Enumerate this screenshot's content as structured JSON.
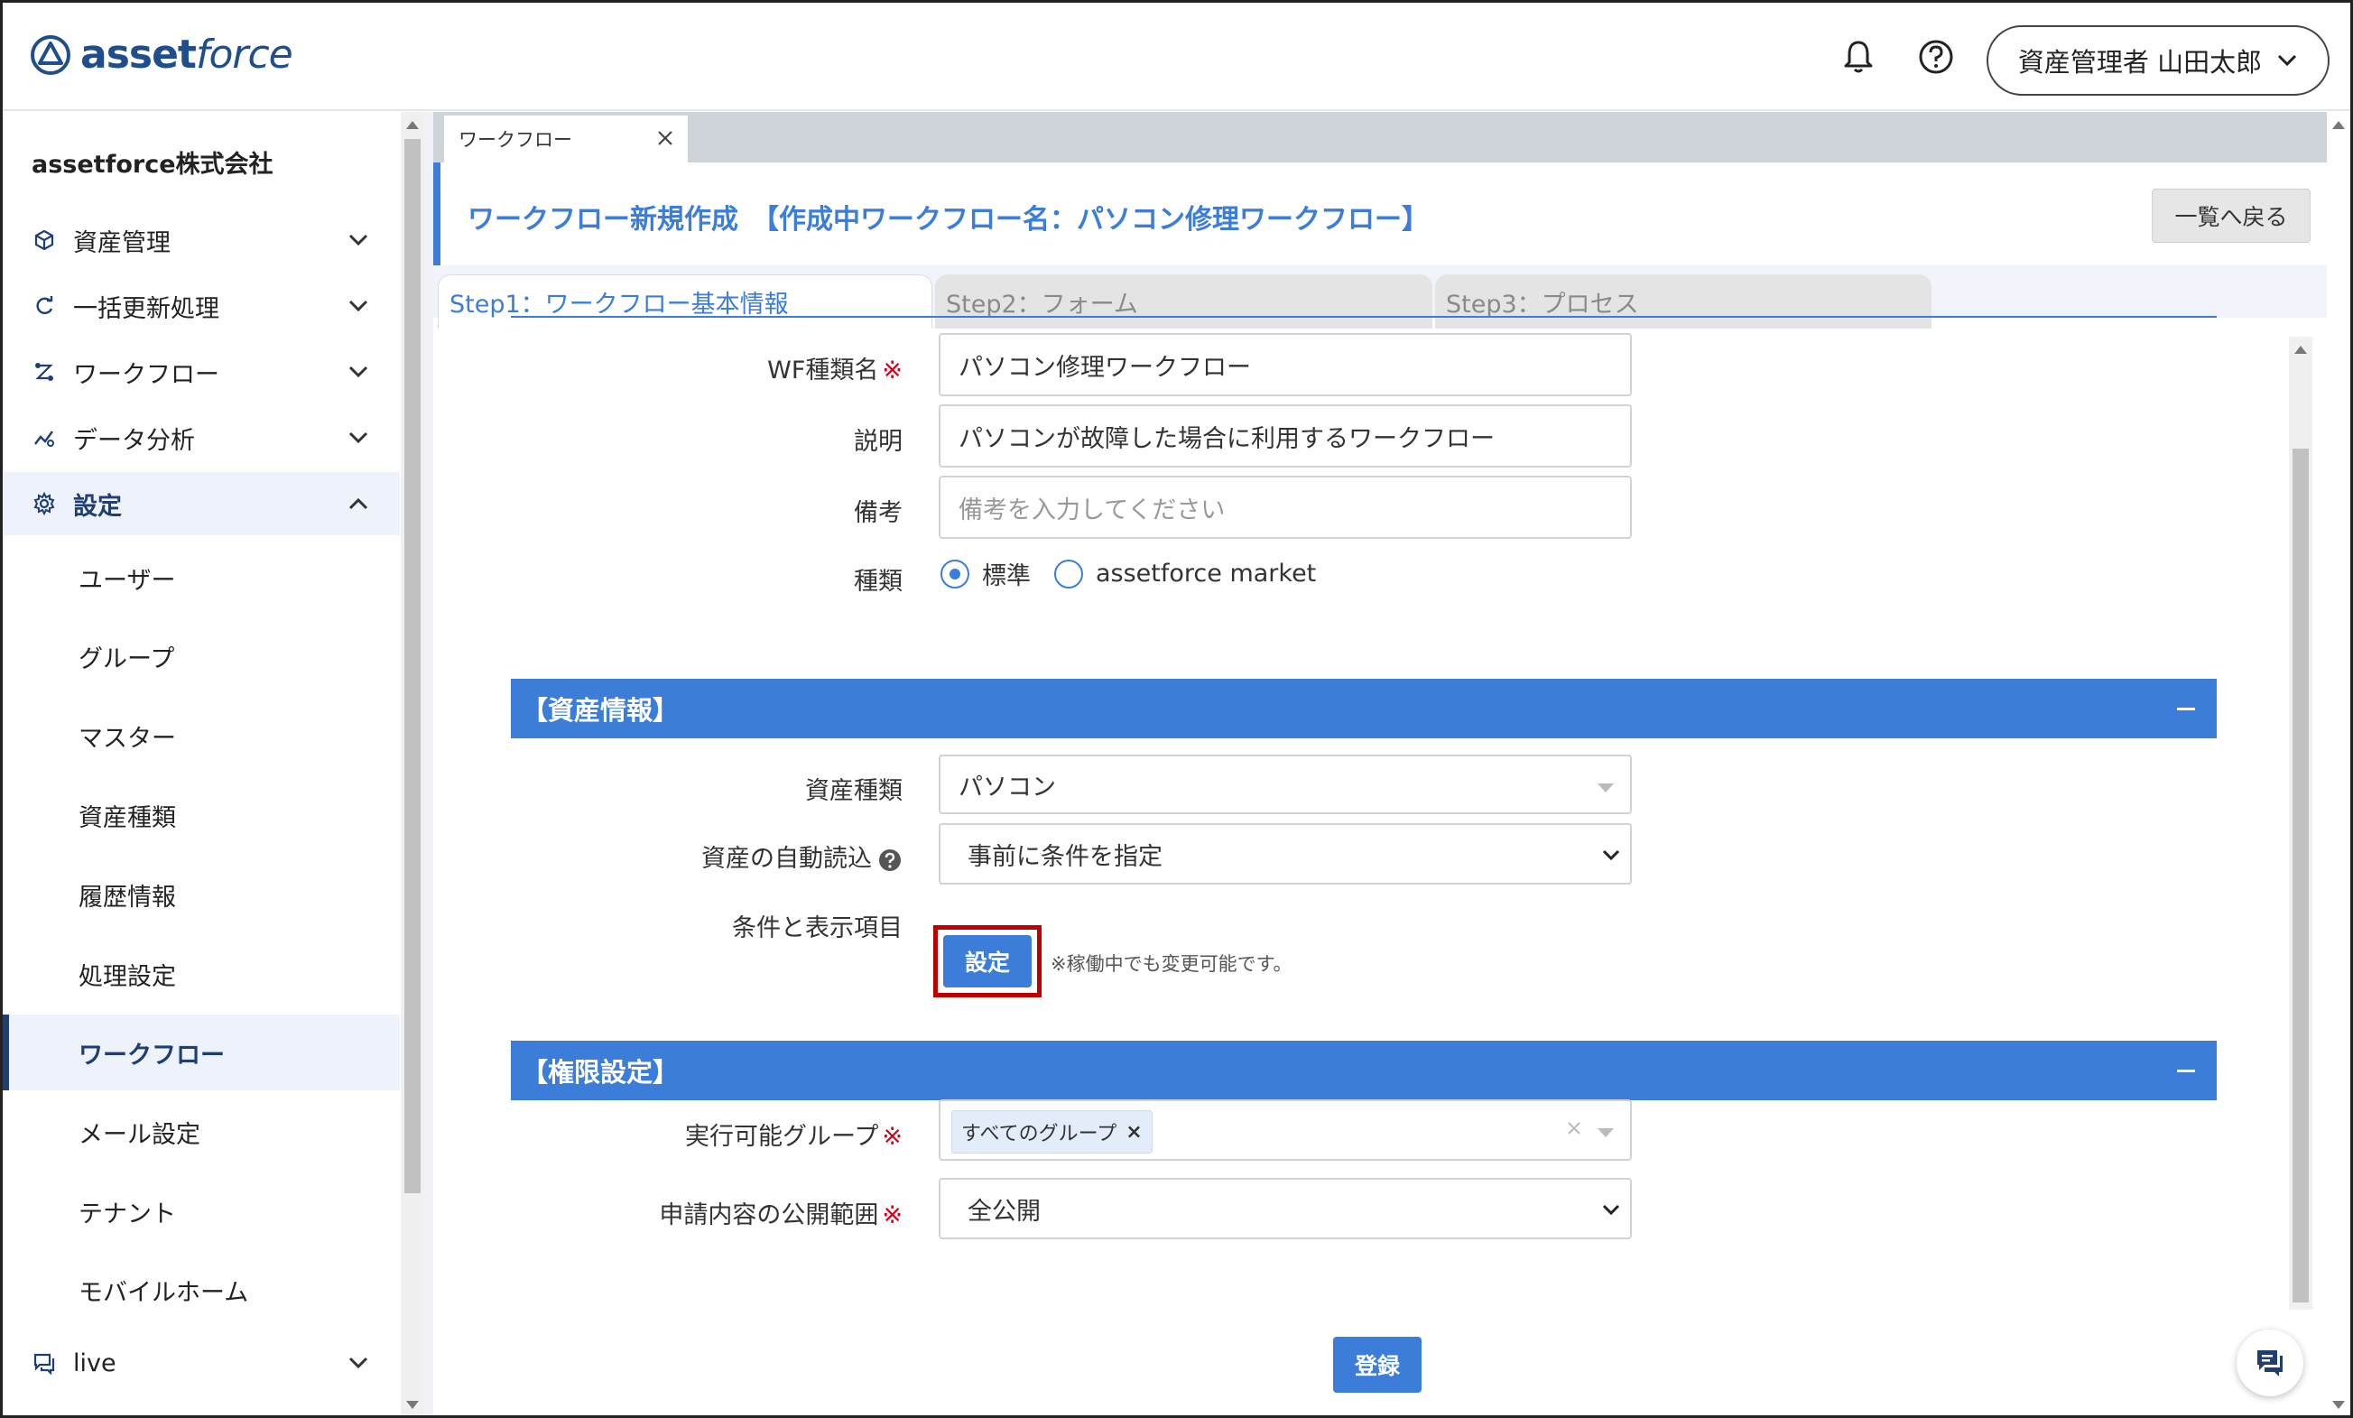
{
  "header": {
    "logo_text_bold": "asset",
    "logo_text_italic": "force",
    "user_menu_label": "資産管理者 山田太郎"
  },
  "sidebar": {
    "company": "assetforce株式会社",
    "items": [
      {
        "label": "資産管理",
        "icon": "cube-icon"
      },
      {
        "label": "一括更新処理",
        "icon": "refresh-icon"
      },
      {
        "label": "ワークフロー",
        "icon": "workflow-icon"
      },
      {
        "label": "データ分析",
        "icon": "chart-icon"
      },
      {
        "label": "設定",
        "icon": "gear-icon"
      }
    ],
    "sub_items": [
      "ユーザー",
      "グループ",
      "マスター",
      "資産種類",
      "履歴情報",
      "処理設定",
      "ワークフロー",
      "メール設定",
      "テナント",
      "モバイルホーム"
    ],
    "live_label": "live"
  },
  "tab": {
    "label": "ワークフロー"
  },
  "page": {
    "title": "ワークフロー新規作成　【作成中ワークフロー名：パソコン修理ワークフロー】",
    "back_label": "一覧へ戻る"
  },
  "steps": [
    "Step1：ワークフロー基本情報",
    "Step2：フォーム",
    "Step3：プロセス"
  ],
  "form": {
    "wf_name_label": "WF種類名",
    "wf_name_value": "パソコン修理ワークフロー",
    "desc_label": "説明",
    "desc_value": "パソコンが故障した場合に利用するワークフロー",
    "note_label": "備考",
    "note_placeholder": "備考を入力してください",
    "type_label": "種類",
    "type_opt_1": "標準",
    "type_opt_2": "assetforce market",
    "required_mark": "※"
  },
  "asset_section": {
    "title": "【資産情報】",
    "asset_type_label": "資産種類",
    "asset_type_value": "パソコン",
    "auto_load_label": "資産の自動読込",
    "auto_load_value": "事前に条件を指定",
    "cond_label": "条件と表示項目",
    "cond_button": "設定",
    "cond_note": "※稼働中でも変更可能です。"
  },
  "perm_section": {
    "title": "【権限設定】",
    "group_label": "実行可能グループ",
    "group_tag": "すべてのグループ",
    "group_tag_remove": "×",
    "scope_label": "申請内容の公開範囲",
    "scope_value": "全公開"
  },
  "submit_label": "登録",
  "colors": {
    "primary": "#3b7dd8",
    "navy": "#1f3f73",
    "highlight": "#c00000",
    "required": "#d0021b"
  }
}
